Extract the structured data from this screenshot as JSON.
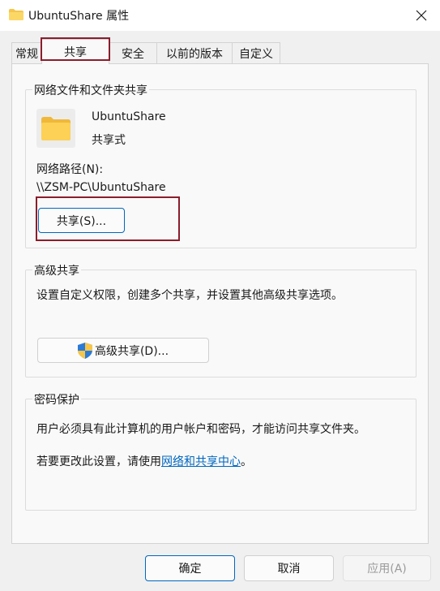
{
  "window": {
    "title": "UbuntuShare 属性",
    "close_label": "✕"
  },
  "tabs": [
    {
      "label": "常规"
    },
    {
      "label": "共享"
    },
    {
      "label": "安全"
    },
    {
      "label": "以前的版本"
    },
    {
      "label": "自定义"
    }
  ],
  "active_tab": "共享",
  "network_sharing": {
    "legend": "网络文件和文件夹共享",
    "folder_name": "UbuntuShare",
    "share_status": "共享式",
    "path_label": "网络路径(N):",
    "path_value": "\\\\ZSM-PC\\UbuntuShare",
    "share_button": "共享(S)..."
  },
  "advanced_sharing": {
    "legend": "高级共享",
    "description": "设置自定义权限，创建多个共享，并设置其他高级共享选项。",
    "button": "高级共享(D)..."
  },
  "password_protection": {
    "legend": "密码保护",
    "description": "用户必须具有此计算机的用户帐户和密码，才能访问共享文件夹。",
    "change_prefix": "若要更改此设置，请使用",
    "change_link": "网络和共享中心",
    "change_suffix": "。"
  },
  "footer": {
    "ok": "确定",
    "cancel": "取消",
    "apply": "应用(A)"
  },
  "colors": {
    "accent": "#0067c0",
    "highlight_box": "#8b1d2c",
    "folder_yellow": "#f6c64a"
  }
}
